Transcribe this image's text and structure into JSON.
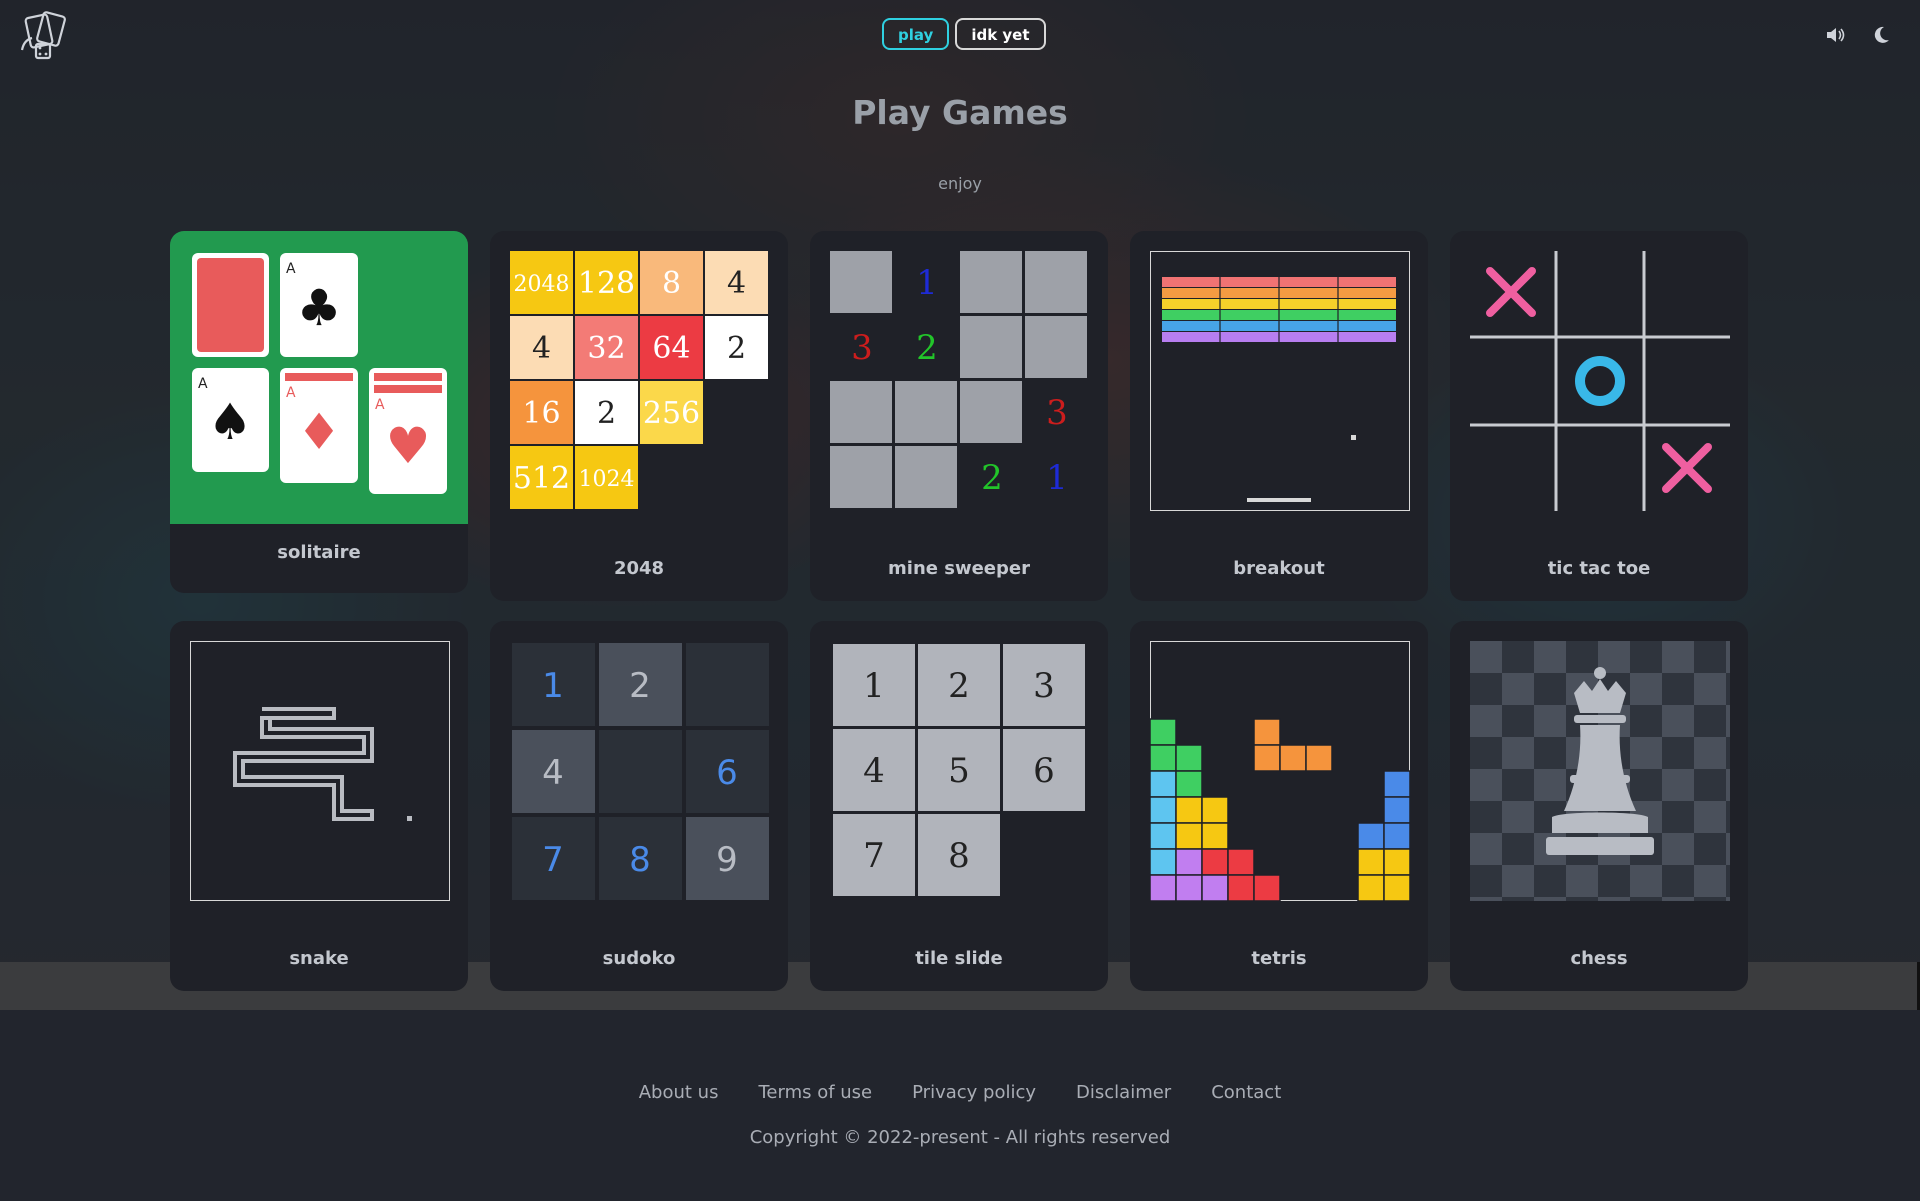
{
  "header": {
    "nav": [
      {
        "label": "play",
        "active": true
      },
      {
        "label": "idk yet",
        "active": false
      }
    ],
    "icons": [
      "sound-icon",
      "moon-icon"
    ]
  },
  "page": {
    "title": "Play Games",
    "subtitle": "enjoy"
  },
  "games": [
    {
      "label": "solitaire"
    },
    {
      "label": "2048"
    },
    {
      "label": "mine sweeper"
    },
    {
      "label": "breakout"
    },
    {
      "label": "tic tac toe"
    },
    {
      "label": "snake"
    },
    {
      "label": "sudoko"
    },
    {
      "label": "tile slide"
    },
    {
      "label": "tetris"
    },
    {
      "label": "chess"
    }
  ],
  "thumbs": {
    "solitaire_cards": [
      "A",
      "A",
      "A",
      "A"
    ],
    "tiles_2048": [
      "2048",
      "128",
      "8",
      "4",
      "4",
      "32",
      "64",
      "2",
      "16",
      "2",
      "256",
      "512",
      "1024"
    ],
    "minesweeper_numbers": [
      "1",
      "3",
      "2",
      "3",
      "2",
      "1"
    ],
    "sudoku": [
      "1",
      "2",
      "4",
      "6",
      "7",
      "8",
      "9"
    ],
    "tile_slide": [
      "1",
      "2",
      "3",
      "4",
      "5",
      "6",
      "7",
      "8"
    ]
  },
  "colors": {
    "accent": "#2fd0e0",
    "solitaire_bg": "#229a4f",
    "card_red": "#e85b5b",
    "tile_2048": "#f6c812",
    "tictac_x": "#ef5fa0",
    "tictac_o": "#39b8e8",
    "sudoku_blue": "#4a8ae8"
  },
  "footer": {
    "links": [
      "About us",
      "Terms of use",
      "Privacy policy",
      "Disclaimer",
      "Contact"
    ],
    "copyright": "Copyright © 2022-present - All rights reserved"
  }
}
